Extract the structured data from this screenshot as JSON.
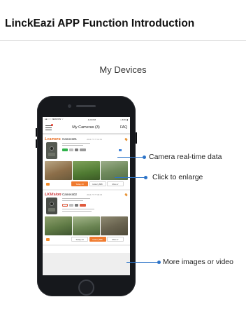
{
  "page": {
    "title": "LinckEazi APP Function Introduction",
    "subtitle": "My Devices"
  },
  "phone_ui": {
    "status_bar": {
      "carrier": "●●○○○ VERIZON ⌔",
      "time": "4:20 PM",
      "battery": "⌁ 83% ▮"
    },
    "nav": {
      "title": "My Cameras (3)",
      "faq_label": "FAQ",
      "menu_icon": "hamburger-icon"
    },
    "cards": [
      {
        "brand": "Lcamera",
        "camera_name": "Camera01",
        "camera_time": "2016-??-?? 13:52",
        "buttons": [
          "Today 23",
          "History 888",
          "More ∨"
        ],
        "selected_button": 0
      },
      {
        "brand": "LKVision",
        "camera_name": "Camera02",
        "camera_time": "2016-??-?? 08:45",
        "buttons": [
          "Today 23",
          "History 888",
          "More ∨"
        ],
        "selected_button": 1
      }
    ]
  },
  "callouts": [
    {
      "label": "Camera real-time data"
    },
    {
      "label": "Click to enlarge"
    },
    {
      "label": "More images or video"
    }
  ],
  "colors": {
    "accent_orange": "#f07a2e",
    "callout_blue": "#2b73c8",
    "phone_body": "#16181c"
  }
}
